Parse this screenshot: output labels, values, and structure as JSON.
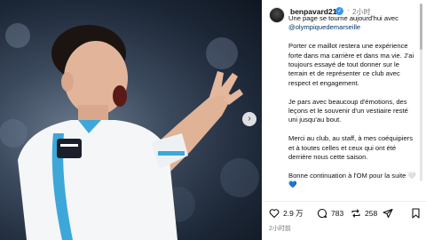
{
  "post": {
    "username": "benpavard21",
    "time_ago": "2小时",
    "mention": "@olympiquedemarseille",
    "caption_lead": "Une page se tourne aujourd'hui avec",
    "paragraphs": [
      "Porter ce maillot restera une expérience forte dans ma carrière et dans ma vie. J'ai toujours essayé de tout donner sur le terrain et de représenter ce club avec respect et engagement.",
      "Je pars avec beaucoup d'émotions, des leçons et le souvenir d'un vestiaire resté uni jusqu'au bout.",
      "Merci au club, au staff, à mes coéquipiers et à toutes celles et ceux qui ont été derrière nous cette saison.",
      "Bonne continuation à l'OM pour la suite 🤍💙"
    ],
    "likes": "2.9 万",
    "comments": "783",
    "reposts": "258",
    "time_bottom": "2小时前"
  },
  "icons": [
    "verified-icon",
    "next-arrow-icon",
    "heart-icon",
    "comment-icon",
    "repost-icon",
    "share-icon",
    "bookmark-icon"
  ],
  "colors": {
    "accent": "#3897f0",
    "mention": "#00376b",
    "jersey_blue": "#3ea7d9"
  }
}
